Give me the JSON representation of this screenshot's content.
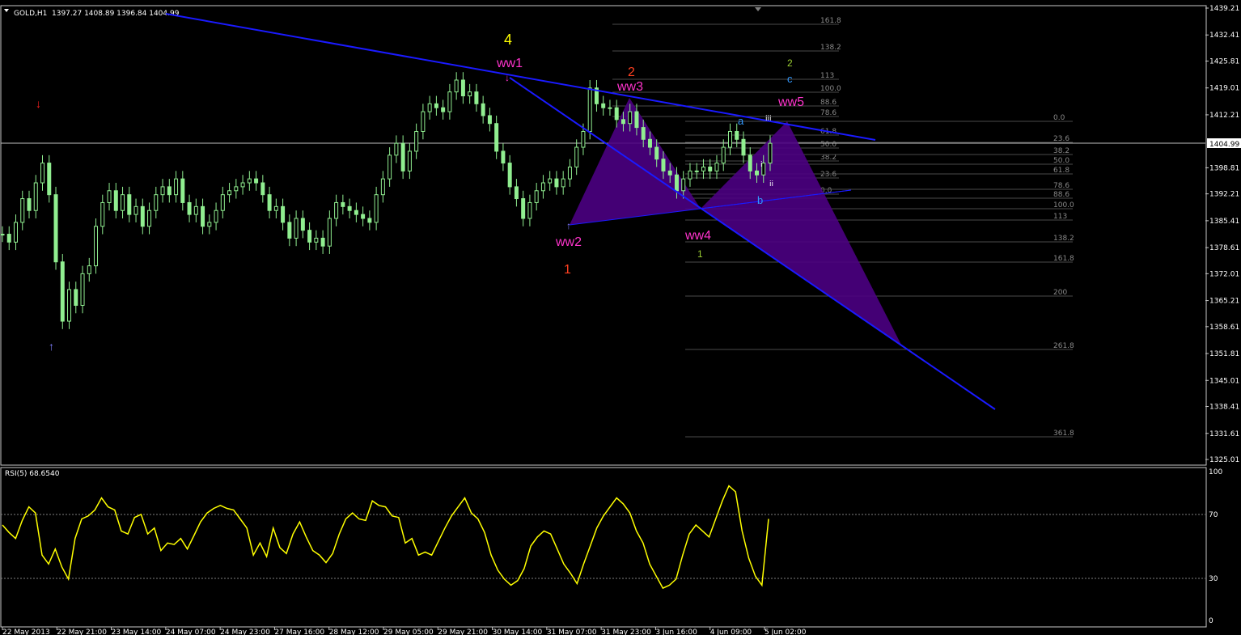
{
  "header": {
    "symbol": "GOLD,H1",
    "ohlc": "1397.27 1408.89 1396.84 1404.99"
  },
  "price_axis": {
    "ticks": [
      "1439.21",
      "1432.41",
      "1425.81",
      "1419.01",
      "1412.21",
      "1398.81",
      "1392.21",
      "1385.41",
      "1378.61",
      "1372.01",
      "1365.21",
      "1358.61",
      "1351.81",
      "1345.01",
      "1338.41",
      "1331.61",
      "1325.01"
    ],
    "current": "1404.99"
  },
  "time_axis": {
    "ticks": [
      "22 May 2013",
      "22 May 21:00",
      "23 May 14:00",
      "24 May 07:00",
      "24 May 23:00",
      "27 May 16:00",
      "28 May 12:00",
      "29 May 05:00",
      "29 May 21:00",
      "30 May 14:00",
      "31 May 07:00",
      "31 May 23:00",
      "3 Jun 16:00",
      "4 Jun 09:00",
      "5 Jun 02:00"
    ]
  },
  "rsi": {
    "label": "RSI(5) 68.6540",
    "levels": [
      "100",
      "70",
      "30",
      "0"
    ]
  },
  "waves": {
    "w4": "4",
    "ww1": "ww1",
    "w2red": "2",
    "ww3": "ww3",
    "ww2": "ww2",
    "w1red": "1",
    "ww4": "ww4",
    "w1green": "1",
    "w2green": "2",
    "c": "c",
    "ww5": "ww5",
    "a": "a",
    "b": "b",
    "iii": "iii",
    "i": "i",
    "ii": "ii"
  },
  "fib_upper": [
    "161.8",
    "138.2",
    "113",
    "100.0",
    "88.6",
    "78.6",
    "61.8",
    "50.0",
    "38.2",
    "23.6",
    "0.0"
  ],
  "fib_right": [
    "0.0",
    "23.6",
    "38.2",
    "50.0",
    "61.8",
    "78.6",
    "88.6",
    "100.0",
    "113",
    "138.2",
    "161.8",
    "200",
    "261.8",
    "361.8"
  ],
  "colors": {
    "candle": "#90ee90",
    "trend": "#1a1aff",
    "pattern": "#4b0082",
    "rsi": "#ffff00",
    "magenta": "#ff33cc"
  },
  "chart_data": {
    "type": "line",
    "title": "GOLD,H1",
    "ylim": [
      1325.01,
      1439.21
    ],
    "series": [
      {
        "name": "GOLD,H1",
        "values": [
          1382,
          1380,
          1385,
          1391,
          1388,
          1395,
          1400,
          1392,
          1375,
          1360,
          1368,
          1364,
          1372,
          1374,
          1384,
          1390,
          1393,
          1388,
          1392,
          1387,
          1389,
          1384,
          1388,
          1392,
          1394,
          1392,
          1396,
          1390,
          1387,
          1389,
          1384,
          1385,
          1388,
          1392,
          1393,
          1394,
          1395,
          1396,
          1395,
          1392,
          1388,
          1389,
          1385,
          1381,
          1386,
          1383,
          1380,
          1381,
          1379,
          1386,
          1390,
          1389,
          1388,
          1387,
          1386,
          1385,
          1392,
          1396,
          1402,
          1405,
          1398,
          1403,
          1408,
          1413,
          1415,
          1414,
          1413,
          1418,
          1421,
          1417,
          1418,
          1415,
          1412,
          1410,
          1403,
          1400,
          1394,
          1391,
          1386,
          1390,
          1393,
          1395,
          1396,
          1394,
          1396,
          1399,
          1404,
          1408,
          1419,
          1415,
          1414,
          1414,
          1411,
          1410,
          1413,
          1409,
          1406,
          1404,
          1401,
          1398,
          1397,
          1393,
          1396,
          1398,
          1398,
          1399,
          1398,
          1400,
          1404,
          1408,
          1406,
          1402,
          1398,
          1397,
          1400,
          1405
        ]
      }
    ],
    "rsi_values": [
      64,
      59,
      55,
      67,
      76,
      72,
      44,
      38,
      48,
      36,
      28,
      55,
      68,
      70,
      74,
      82,
      76,
      74,
      60,
      58,
      69,
      71,
      58,
      62,
      47,
      52,
      51,
      55,
      48,
      57,
      66,
      72,
      75,
      77,
      75,
      74,
      68,
      62,
      44,
      52,
      43,
      62,
      49,
      45,
      58,
      66,
      56,
      47,
      44,
      39,
      45,
      58,
      68,
      72,
      68,
      67,
      80,
      77,
      76,
      70,
      69,
      52,
      55,
      44,
      46,
      44,
      53,
      62,
      70,
      76,
      82,
      72,
      68,
      59,
      44,
      34,
      28,
      24,
      27,
      35,
      50,
      56,
      60,
      58,
      48,
      38,
      32,
      25,
      38,
      50,
      62,
      70,
      76,
      82,
      78,
      72,
      60,
      52,
      38,
      30,
      22,
      24,
      28,
      44,
      58,
      64,
      60,
      56,
      68,
      80,
      90,
      86,
      60,
      42,
      30,
      24,
      68
    ]
  }
}
